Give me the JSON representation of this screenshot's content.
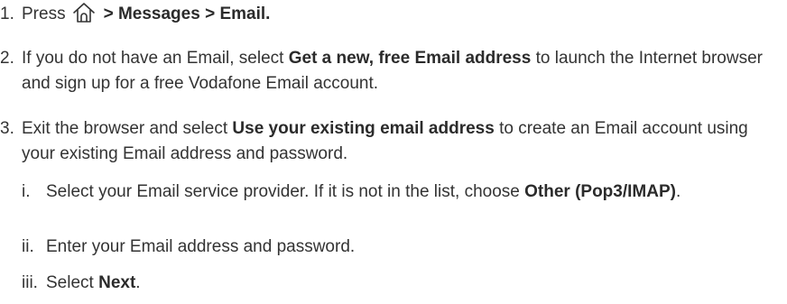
{
  "steps": [
    {
      "num": "1.",
      "press": "Press",
      "icon": "home-icon",
      "path": "> Messages > Email."
    },
    {
      "num": "2.",
      "pre": "If you do not have an Email, select",
      "bold": "Get a new, free Email address",
      "post": "to launch the Internet browser and sign up for a free Vodafone Email account."
    },
    {
      "num": "3.",
      "pre": "Exit the browser and select",
      "bold": "Use your existing email address",
      "post": "to create an Email account using your existing Email address and password."
    }
  ],
  "substeps": [
    {
      "num": "i.",
      "pre": "Select your Email service provider. If it is not in the list, choose",
      "bold": "Other (Pop3/IMAP)",
      "post": "."
    },
    {
      "num": "ii.",
      "text": "Enter your Email address and password."
    },
    {
      "num": "iii.",
      "pre": "Select",
      "bold": "Next",
      "post": "."
    }
  ]
}
